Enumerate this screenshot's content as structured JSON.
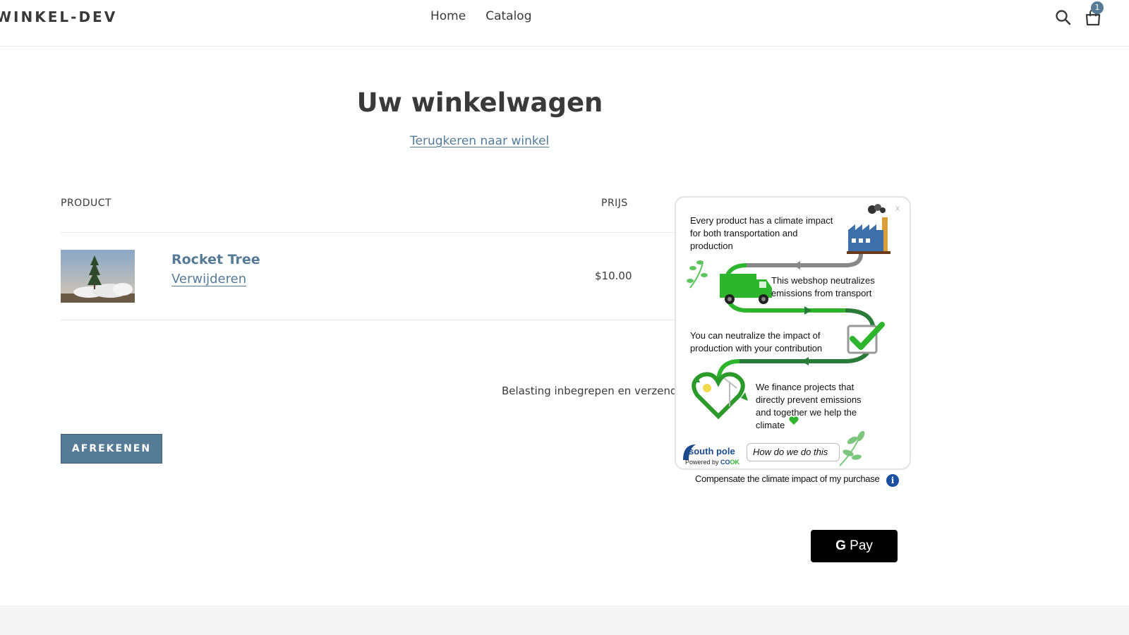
{
  "header": {
    "logo": "WINKEL-DEV",
    "nav": [
      "Home",
      "Catalog"
    ],
    "cart_count": "1"
  },
  "main": {
    "title": "Uw winkelwagen",
    "back_link": "Terugkeren naar winkel",
    "columns": {
      "product": "PRODUCT",
      "price": "PRIJS"
    },
    "items": [
      {
        "name": "Rocket Tree",
        "remove_label": "Verwijderen",
        "price": "$10.00"
      }
    ],
    "tax_note": "Belasting inbegrepen en verzend",
    "checkout_label": "AFREKENEN"
  },
  "widget": {
    "close": "x",
    "text_1": "Every product has a climate impact for both transportation and production",
    "text_2": "This webshop neutralizes emissions from transport",
    "text_3": "You can neutralize the impact of production with your contribution",
    "text_4": "We finance projects that directly prevent emissions and together we help the climate",
    "brand": "south pole",
    "powered_prefix": "Powered by",
    "powered_brand": "CO",
    "powered_suffix": "OK",
    "how_button": "How do we do this",
    "compensate_label": "Compensate the climate impact of my purchase",
    "info": "i"
  },
  "payment": {
    "gpay_g": "G",
    "gpay_label": "Pay"
  },
  "colors": {
    "accent": "#557b97",
    "widget_green": "#2db52d",
    "widget_dark_green": "#2a7a3a",
    "info_blue": "#1a4fa0"
  }
}
